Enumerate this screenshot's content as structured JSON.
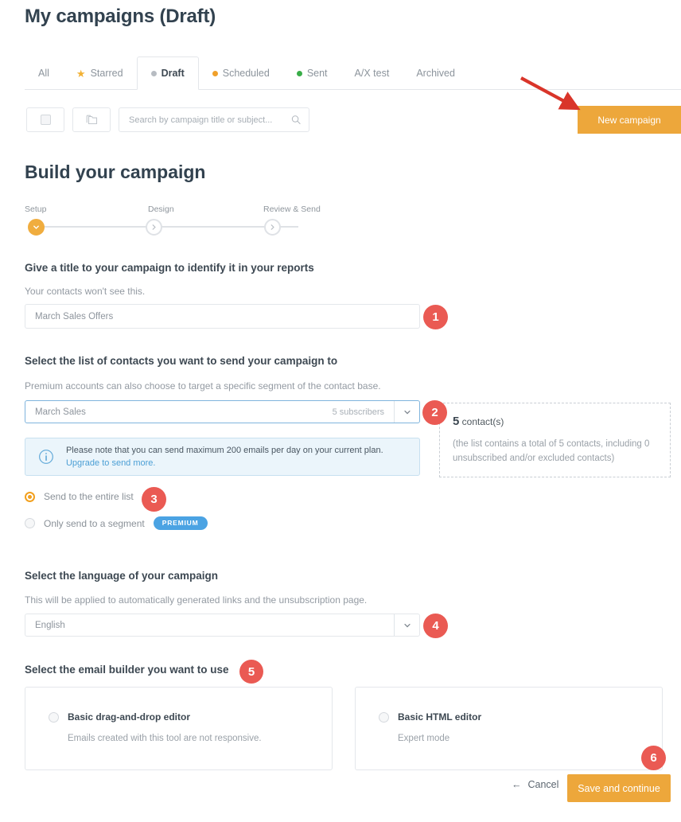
{
  "page": {
    "title": "My campaigns (Draft)",
    "section_title": "Build your campaign"
  },
  "tabs": [
    {
      "label": "All",
      "marker": "none",
      "active": false
    },
    {
      "label": "Starred",
      "marker": "star",
      "active": false
    },
    {
      "label": "Draft",
      "marker": "dot",
      "dot_color": "#b7bcc2",
      "active": true
    },
    {
      "label": "Scheduled",
      "marker": "dot",
      "dot_color": "#f0a02a",
      "active": false
    },
    {
      "label": "Sent",
      "marker": "dot",
      "dot_color": "#39ad48",
      "active": false
    },
    {
      "label": "A/X test",
      "marker": "none",
      "active": false
    },
    {
      "label": "Archived",
      "marker": "none",
      "active": false
    }
  ],
  "toolbar": {
    "select_all_name": "select-all-checkbox",
    "folder_name": "folder-icon",
    "search_placeholder": "Search by campaign title or subject...",
    "search_value": "",
    "new_campaign_label": "New campaign"
  },
  "stepper": {
    "steps": [
      {
        "label": "Setup",
        "state": "done"
      },
      {
        "label": "Design",
        "state": "pending"
      },
      {
        "label": "Review & Send",
        "state": "pending"
      }
    ]
  },
  "campaign_title": {
    "heading": "Give a title to your campaign to identify it in your reports",
    "subtext": "Your contacts won't see this.",
    "value": "March Sales Offers"
  },
  "contact_list": {
    "heading": "Select the list of contacts you want to send your campaign to",
    "subtext": "Premium accounts can also choose to target a specific segment of the contact base.",
    "selected": "March Sales",
    "meta": "5 subscribers"
  },
  "info_notice": {
    "text": "Please note that you can send maximum 200 emails per day on your current plan. ",
    "link_text": "Upgrade to send more."
  },
  "contacts_panel": {
    "count": "5",
    "count_suffix": " contact(s)",
    "note": "(the list contains a total of 5 contacts, including 0 unsubscribed and/or excluded contacts)"
  },
  "send_options": {
    "entire_list_label": "Send to the entire list",
    "segment_label": "Only send to a segment",
    "premium_badge": "PREMIUM"
  },
  "language": {
    "heading": "Select the language of your campaign",
    "subtext": "This will be applied to automatically generated links and the unsubscription page.",
    "selected": "English"
  },
  "builder": {
    "heading": "Select the email builder you want to use",
    "options": [
      {
        "title": "Basic drag-and-drop editor",
        "subtitle": "Emails created with this tool are not responsive."
      },
      {
        "title": "Basic HTML editor",
        "subtitle": "Expert mode"
      }
    ]
  },
  "footer": {
    "cancel_label": "Cancel",
    "save_label": "Save and continue"
  },
  "annotations": [
    {
      "number": "1"
    },
    {
      "number": "2"
    },
    {
      "number": "3"
    },
    {
      "number": "4"
    },
    {
      "number": "5"
    },
    {
      "number": "6"
    }
  ],
  "colors": {
    "accent_orange": "#eda73b",
    "annotation_red": "#ea5a53",
    "premium_blue": "#4ba3e3",
    "arrow_red": "#d9352a"
  }
}
